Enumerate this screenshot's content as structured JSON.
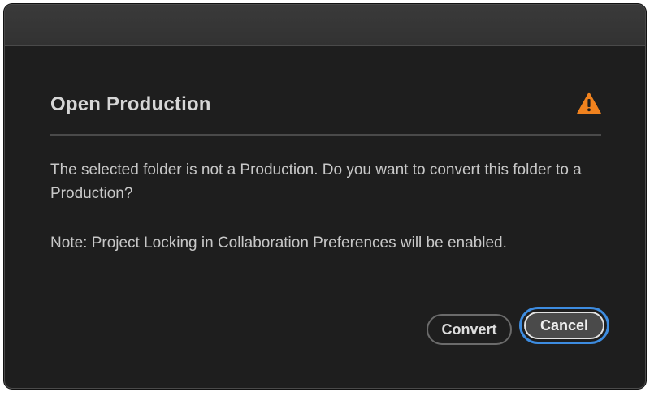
{
  "dialog": {
    "title": "Open Production",
    "message": "The selected folder is not a Production. Do you want to convert this folder to a Production?",
    "note": "Note: Project Locking in Collaboration Preferences will be enabled.",
    "icon": "warning-icon",
    "buttons": {
      "convert_label": "Convert",
      "cancel_label": "Cancel"
    }
  },
  "colors": {
    "background": "#1e1e1e",
    "titlebar": "#353535",
    "warning": "#f0821e",
    "focus_ring": "#3d8ce0"
  }
}
